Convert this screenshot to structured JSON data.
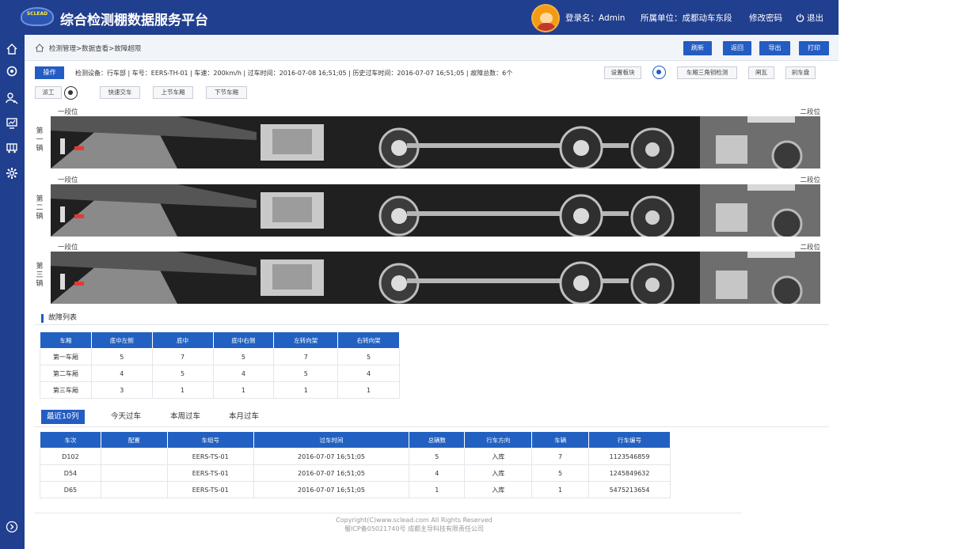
{
  "header": {
    "logo_text": "SCLEAD",
    "title": "综合检测棚数据服务平台",
    "login": "登录名：Admin",
    "unit": "所属单位：成都动车东段",
    "change_password": "修改密码",
    "logout": "退出"
  },
  "sidebar": {
    "icons": [
      "home-icon",
      "circle-icon",
      "search-people-icon",
      "monitor-icon",
      "train-icon",
      "gear-icon",
      "expand-icon"
    ]
  },
  "breadcrumb": "检测管理>数据查看>故障超限",
  "toolbar": {
    "refresh": "刷新",
    "back": "返回",
    "export": "导出",
    "print": "打印"
  },
  "info": {
    "operate": "操作",
    "details": "检测设备：行车部  |  车号：EERS-TH-01  |  车速：200km/h  |  过车时间：2016-07-08 16;51;05  |  历史过车时间：2016-07-07 16;51;05  |  故障总数：6个",
    "set_block": "设置板块",
    "triangle": "车厢三角钥检测",
    "brake_shoe": "闸瓦",
    "brake_disc": "刹车盘"
  },
  "actions": {
    "dispatch": "派工",
    "quick_pass": "快速交车",
    "prev_car": "上节车厢",
    "next_car": "下节车厢"
  },
  "vehicles": [
    {
      "label": "第一辆",
      "left": "一段位",
      "right": "二段位"
    },
    {
      "label": "第二辆",
      "left": "一段位",
      "right": "二段位"
    },
    {
      "label": "第三辆",
      "left": "一段位",
      "right": "二段位"
    }
  ],
  "fault_list": {
    "title": "故障列表",
    "headers": [
      "车厢",
      "底中左侧",
      "底中",
      "底中右侧",
      "左转向架",
      "右转向架"
    ],
    "rows": [
      [
        "第一车厢",
        "5",
        "7",
        "5",
        "7",
        "5"
      ],
      [
        "第二车厢",
        "4",
        "5",
        "4",
        "5",
        "4"
      ],
      [
        "第三车厢",
        "3",
        "1",
        "1",
        "1",
        "1"
      ]
    ]
  },
  "tabs": [
    "最近10列",
    "今天过车",
    "本周过车",
    "本月过车"
  ],
  "pass_table": {
    "headers": [
      "车次",
      "配置",
      "车组号",
      "过车时间",
      "总辆数",
      "行车方向",
      "车辆",
      "行车编号"
    ],
    "rows": [
      [
        "D102",
        "",
        "EERS-TS-01",
        "2016-07-07 16;51;05",
        "5",
        "入库",
        "7",
        "1123546859"
      ],
      [
        "D54",
        "",
        "EERS-TS-01",
        "2016-07-07 16;51;05",
        "4",
        "入库",
        "5",
        "1245849632"
      ],
      [
        "D65",
        "",
        "EERS-TS-01",
        "2016-07-07 16;51;05",
        "1",
        "入库",
        "1",
        "5475213654"
      ]
    ]
  },
  "footer": {
    "copyright": "Copyright(C)www.sclead.com All Rights Reserved",
    "icp": "蜀ICP备05021740号  成都主导科技有限责任公司"
  },
  "colors": {
    "primary": "#213f8f",
    "accent": "#235cc2",
    "table_header": "#2261c1"
  }
}
